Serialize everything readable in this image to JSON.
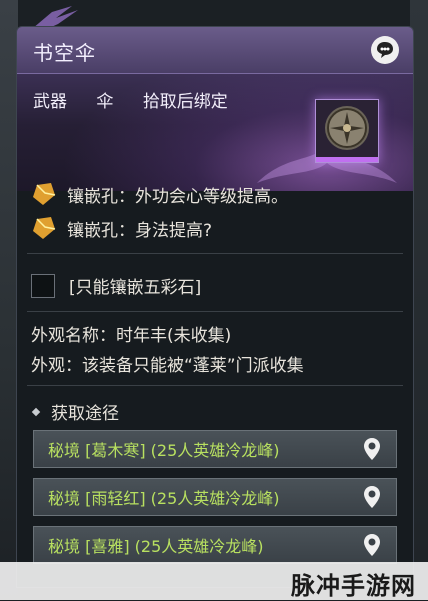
{
  "tooltip": {
    "title": "书空伞",
    "meta": [
      "武器",
      "伞",
      "拾取后绑定"
    ],
    "socket_partial": "镶嵌孔：外功会心等级提高。",
    "socket_2": "镶嵌孔：身法提高?",
    "colored_stone": "[只能镶嵌五彩石]",
    "appearance_name": "外观名称：时年丰(未收集)",
    "appearance_note": "外观：该装备只能被“蓬莱”门派收集",
    "acquire_header": "获取途径",
    "sources": [
      {
        "label": "秘境 [葛木寒] (25人英雄冷龙峰)"
      },
      {
        "label": "秘境 [雨轻红] (25人英雄冷龙峰)"
      },
      {
        "label": "秘境 [喜雅] (25人英雄冷龙峰)"
      }
    ]
  },
  "watermark": "脉冲手游网",
  "colors": {
    "source_text": "#b8e060",
    "quality_purple": "#c070f0"
  },
  "icons": [
    "bird-icon",
    "chat-icon",
    "umbrella-item-icon",
    "gem-icon",
    "location-pin-icon"
  ]
}
